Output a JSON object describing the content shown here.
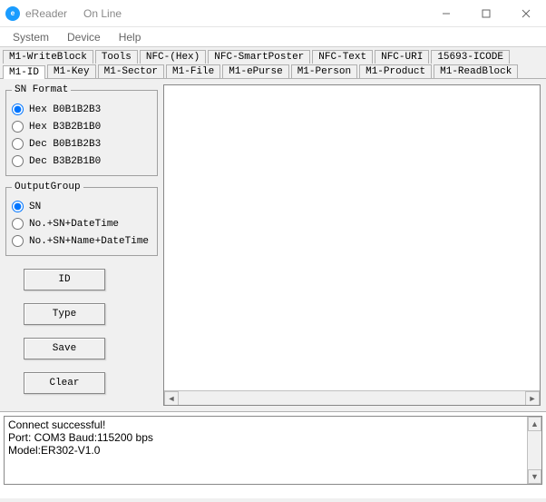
{
  "window": {
    "title": "eReader",
    "status": "On Line"
  },
  "menus": {
    "system": "System",
    "device": "Device",
    "help": "Help"
  },
  "tabs": {
    "row1": [
      "M1-WriteBlock",
      "Tools",
      "NFC-(Hex)",
      "NFC-SmartPoster",
      "NFC-Text",
      "NFC-URI",
      "15693-ICODE"
    ],
    "row2": [
      "M1-ID",
      "M1-Key",
      "M1-Sector",
      "M1-File",
      "M1-ePurse",
      "M1-Person",
      "M1-Product",
      "M1-ReadBlock"
    ],
    "active": "M1-ID"
  },
  "sn_format": {
    "legend": "SN Format",
    "options": [
      "Hex B0B1B2B3",
      "Hex B3B2B1B0",
      "Dec B0B1B2B3",
      "Dec B3B2B1B0"
    ],
    "selected": "Hex B0B1B2B3"
  },
  "output_group": {
    "legend": "OutputGroup",
    "options": [
      "SN",
      "No.+SN+DateTime",
      "No.+SN+Name+DateTime"
    ],
    "selected": "SN"
  },
  "buttons": {
    "id": "ID",
    "type": "Type",
    "save": "Save",
    "clear": "Clear"
  },
  "status_log": {
    "line1": "Connect successful!",
    "line2": "Port: COM3 Baud:115200 bps",
    "line3": "Model:ER302-V1.0"
  }
}
